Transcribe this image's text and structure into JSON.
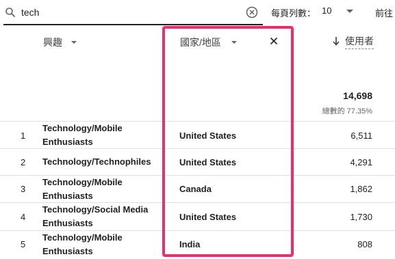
{
  "search": {
    "value": "tech"
  },
  "pagination": {
    "rows_per_page_label": "每頁列數：",
    "rows_per_page_value": "10",
    "prev_label": "前往"
  },
  "columns": {
    "interest": "興趣",
    "country": "國家/地區",
    "users": "使用者"
  },
  "totals": {
    "users": "14,698",
    "users_pct": "總數的 77.35%"
  },
  "rows": [
    {
      "index": "1",
      "interest": "Technology/Mobile Enthusiasts",
      "country": "United States",
      "users": "6,511"
    },
    {
      "index": "2",
      "interest": "Technology/Technophiles",
      "country": "United States",
      "users": "4,291"
    },
    {
      "index": "3",
      "interest": "Technology/Mobile Enthusiasts",
      "country": "Canada",
      "users": "1,862"
    },
    {
      "index": "4",
      "interest": "Technology/Social Media Enthusiasts",
      "country": "United States",
      "users": "1,730"
    },
    {
      "index": "5",
      "interest": "Technology/Mobile Enthusiasts",
      "country": "India",
      "users": "808"
    }
  ],
  "colors": {
    "highlight": "#ee2d6e",
    "row_border": "#e0e0e0",
    "text": "#202124"
  },
  "icons": {
    "search": "search-icon",
    "clear": "clear-circle-icon",
    "close": "close-icon",
    "sort": "arrow-down-icon",
    "dropdown": "caret-down-icon"
  }
}
